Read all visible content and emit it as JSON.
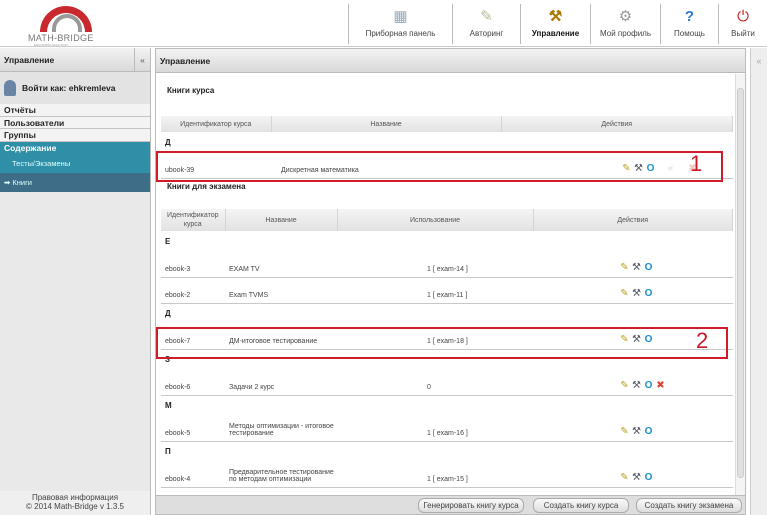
{
  "header": {
    "logo": "MATH-BRIDGE",
    "logo_sub": "EDUCATION SOLUTION",
    "nav": [
      {
        "label": "Приборная панель",
        "icon": "dashboard-icon"
      },
      {
        "label": "Авторинг",
        "icon": "authoring-icon"
      },
      {
        "label": "Управление",
        "icon": "management-icon",
        "active": true
      },
      {
        "label": "Мой профиль",
        "icon": "profile-gear-icon"
      },
      {
        "label": "Помощь",
        "icon": "help-icon"
      },
      {
        "label": "Выйти",
        "icon": "logout-icon"
      }
    ]
  },
  "sidebar": {
    "title": "Управление",
    "collapse": "«",
    "user": "Войти как: ehkremleva",
    "menu": [
      "Отчёты",
      "Пользователи",
      "Группы",
      "Содержание"
    ],
    "submenu": [
      "Тесты/Экзамены",
      "Книги"
    ],
    "footer_line1": "Правовая информация",
    "footer_line2": "© 2014 Math-Bridge v 1.3.5"
  },
  "main": {
    "title": "Управление",
    "course_books": {
      "title": "Книги курса",
      "headers": [
        "Идентификатор курса",
        "Название",
        "Действия"
      ],
      "groups": [
        {
          "letter": "Д",
          "rows": [
            {
              "id": "ubook-39",
              "name": "Дискретная математика"
            }
          ]
        }
      ]
    },
    "exam_books": {
      "title": "Книги для экзамена",
      "headers": [
        "Идентификатор курса",
        "Название",
        "Использование",
        "Действия"
      ],
      "groups": [
        {
          "letter": "Е",
          "rows": [
            {
              "id": "ebook-3",
              "name": "EXAM TV",
              "usage": "1 [ exam-14 ]"
            },
            {
              "id": "ebook-2",
              "name": "Exam TVMS",
              "usage": "1 [ exam-11 ]"
            }
          ]
        },
        {
          "letter": "Д",
          "rows": [
            {
              "id": "ebook-7",
              "name": "ДМ-итоговое тестирование",
              "usage": "1 [ exam-18 ]"
            }
          ]
        },
        {
          "letter": "З",
          "rows": [
            {
              "id": "ebook-6",
              "name": "Задачи 2 курс",
              "usage": "0"
            }
          ]
        },
        {
          "letter": "М",
          "rows": [
            {
              "id": "ebook-5",
              "name": "Методы оптимизации - итоговое тестирование",
              "usage": "1 [ exam-16 ]"
            }
          ]
        },
        {
          "letter": "П",
          "rows": [
            {
              "id": "ebook-4",
              "name": "Предварительное тестирование по методам оптимизации",
              "usage": "1 [ exam-15 ]"
            }
          ]
        }
      ]
    },
    "annotations": [
      "1",
      "2"
    ],
    "buttons": [
      "Генерировать книгу курса",
      "Создать книгу курса",
      "Создать книгу экзамена"
    ]
  },
  "colors": {
    "accent": "#2f8fa7",
    "highlight": "#d01c2a"
  }
}
